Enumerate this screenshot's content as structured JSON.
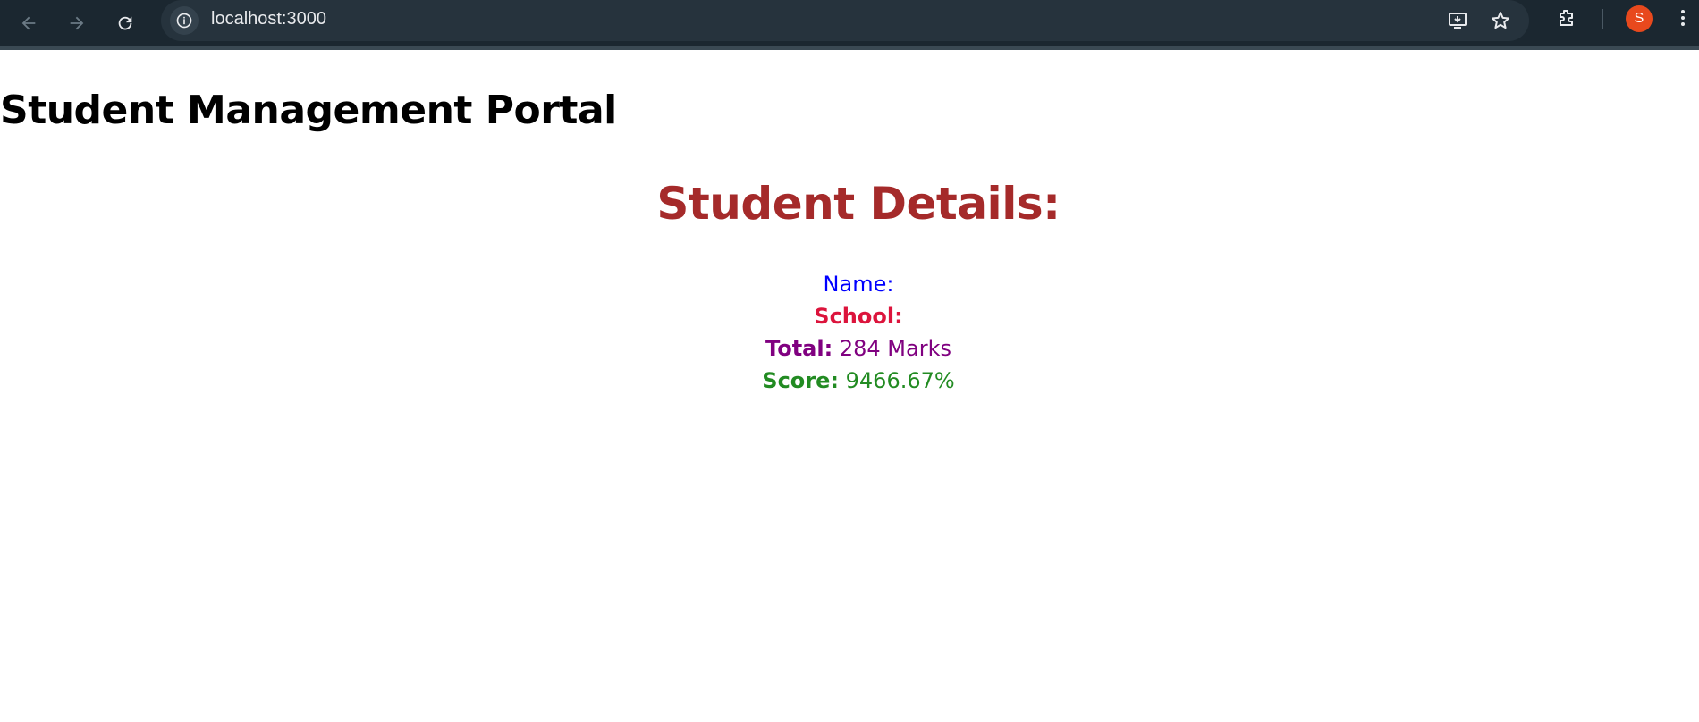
{
  "browser": {
    "url": "localhost:3000",
    "profile_initial": "S",
    "icons": [
      "back-arrow-icon",
      "forward-arrow-icon",
      "reload-icon",
      "info-icon",
      "install-app-icon",
      "star-icon",
      "extensions-icon",
      "kebab-menu-icon"
    ],
    "accent_avatar": "#e8491d"
  },
  "page": {
    "title": "Student Management Portal",
    "details_heading": "Student Details:",
    "name_label": "Name:",
    "name_value": "",
    "school_label": "School:",
    "school_value": "",
    "total_label": "Total:",
    "total_value": "284 Marks",
    "score_label": "Score:",
    "score_value": "9466.67%"
  },
  "colors": {
    "heading": "#a52a2a",
    "name": "#0000ff",
    "school": "#dc143c",
    "total": "#800080",
    "score": "#228b22"
  }
}
